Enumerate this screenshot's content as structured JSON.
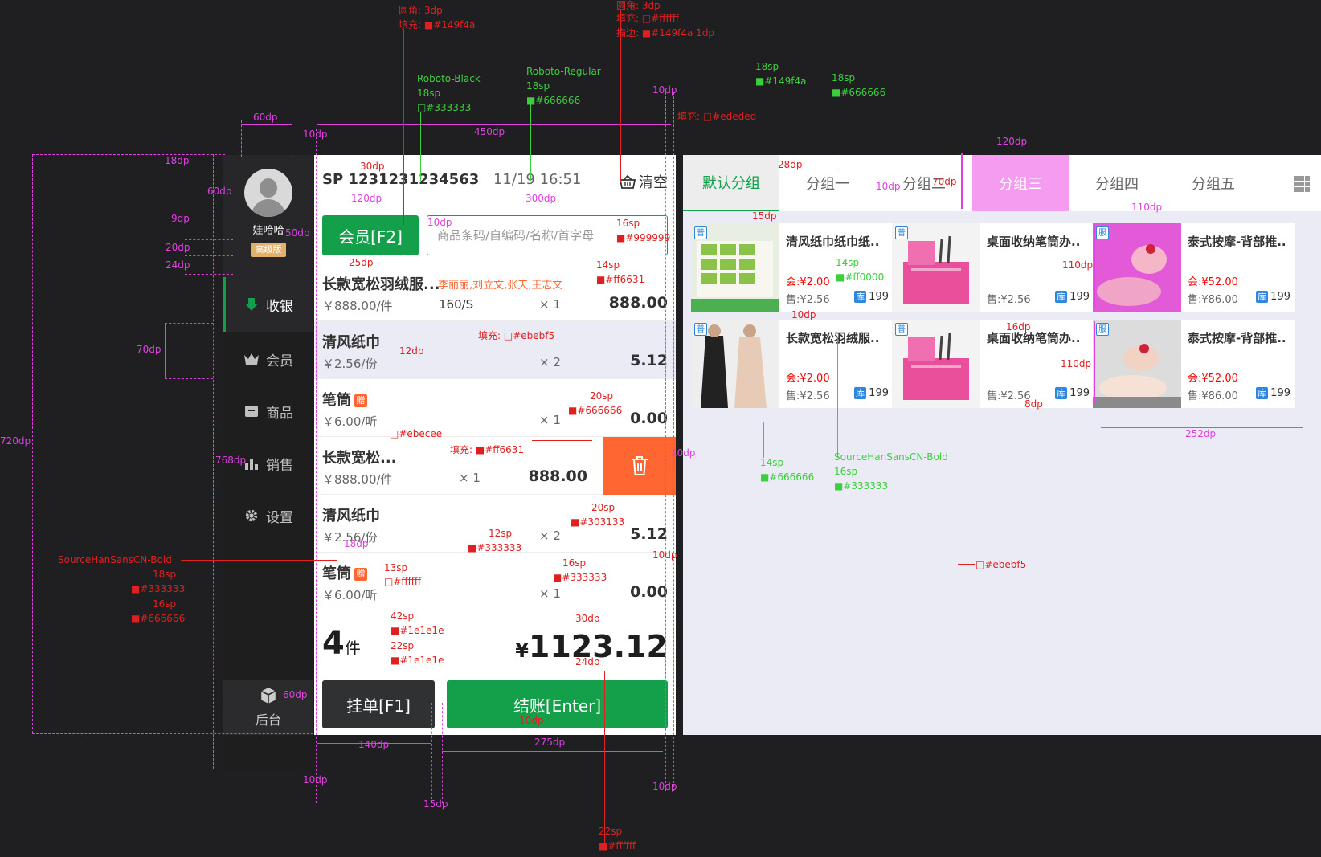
{
  "sidebar": {
    "user_name": "娃哈哈",
    "user_level": "高级版",
    "nav": [
      {
        "label": "收银",
        "icon": "download-arrow-icon",
        "active": true
      },
      {
        "label": "会员",
        "icon": "crown-icon",
        "active": false
      },
      {
        "label": "商品",
        "icon": "box-icon",
        "active": false
      },
      {
        "label": "销售",
        "icon": "bar-chart-icon",
        "active": false
      },
      {
        "label": "设置",
        "icon": "gear-icon",
        "active": false
      }
    ],
    "backend_label": "后台"
  },
  "cart": {
    "order_no": "SP 1231231234563",
    "order_time": "11/19  16:51",
    "clear_label": "清空",
    "member_button": "会员[F2]",
    "search_placeholder": "商品条码/自编码/名称/首字母",
    "items": [
      {
        "name": "长款宽松羽绒服...",
        "members": "李丽丽,刘立文,张天,王志文",
        "price": "￥888.00/件",
        "spec": "160/S",
        "qty": "× 1",
        "total": "888.00"
      },
      {
        "name": "清风纸巾",
        "price": "￥2.56/份",
        "qty": "× 2",
        "total": "5.12",
        "highlight": true
      },
      {
        "name": "笔筒",
        "gift": "赠",
        "price": "￥6.00/听",
        "qty": "× 1",
        "total": "0.00"
      },
      {
        "name": "长款宽松...",
        "price": "￥888.00/件",
        "qty": "× 1",
        "total": "888.00",
        "delete": true
      },
      {
        "name": "清风纸巾",
        "price": "￥2.56/份",
        "qty": "× 2",
        "total": "5.12"
      },
      {
        "name": "笔筒",
        "gift": "赠",
        "price": "￥6.00/听",
        "qty": "× 1",
        "total": "0.00"
      }
    ],
    "count": "4",
    "count_unit": "件",
    "currency": "¥",
    "total": "1123.12",
    "hold_button": "挂单[F1]",
    "pay_button": "结账[Enter]"
  },
  "products": {
    "tabs": [
      "默认分组",
      "分组一",
      "分组二",
      "分组三",
      "分组四",
      "分组五"
    ],
    "cards": [
      {
        "name": "清风纸巾纸巾纸..",
        "badge": "普",
        "member": "会:¥2.00",
        "sale": "售:¥2.56",
        "stock_label": "库",
        "stock": "199",
        "img": "tissue"
      },
      {
        "name": "桌面收纳笔筒办..",
        "badge": "普",
        "member": "",
        "sale": "售:¥2.56",
        "stock_label": "库",
        "stock": "199",
        "img": "pen"
      },
      {
        "name": "泰式按摩-背部推..",
        "badge": "服",
        "member": "会:¥52.00",
        "sale": "售:¥86.00",
        "stock_label": "库",
        "stock": "199",
        "img": "spa-pink"
      },
      {
        "name": "长款宽松羽绒服..",
        "badge": "普",
        "member": "会:¥2.00",
        "sale": "售:¥2.56",
        "stock_label": "库",
        "stock": "199",
        "img": "coat"
      },
      {
        "name": "桌面收纳笔筒办..",
        "badge": "普",
        "member": "",
        "sale": "售:¥2.56",
        "stock_label": "库",
        "stock": "199",
        "img": "pen"
      },
      {
        "name": "泰式按摩-背部推..",
        "badge": "服",
        "member": "会:¥52.00",
        "sale": "售:¥86.00",
        "stock_label": "库",
        "stock": "199",
        "img": "spa"
      }
    ]
  },
  "annotations": {
    "a01": "圆角: 3dp",
    "a02": "填充: ■#149f4a",
    "a03": "圆角: 3dp",
    "a04": "填充: □#ffffff",
    "a05": "描边: ■#149f4a 1dp",
    "a06": "Roboto-Black",
    "a07": "18sp",
    "a08": "□#333333",
    "a09": "Roboto-Regular",
    "a10": "18sp",
    "a11": "■#666666",
    "a12": "18sp",
    "a13": "■#149f4a",
    "a14": "18sp",
    "a15": "■#666666",
    "a16": "10dp",
    "a17": "填充: □#ededed",
    "a18": "120dp",
    "a19": "60dp",
    "a20": "10dp",
    "a21": "450dp",
    "a22": "18dp",
    "a23": "60dp",
    "a24": "9dp",
    "a25": "20dp",
    "a26": "24dp",
    "a27": "50dp",
    "a28": "30dp",
    "a29": "120dp",
    "a30": "300dp",
    "a31": "28dp",
    "a32": "10dp",
    "a33": "70dp",
    "a34": "15dp",
    "a35": "110dp",
    "a36": "16sp",
    "a37": "■#999999",
    "a38": "10dp",
    "a39": "25dp",
    "a40": "14sp",
    "a41": "■#ff6631",
    "a42": "14sp",
    "a43": "■#ff0000",
    "a44": "110dp",
    "a45": "10dp",
    "a46": "70dp",
    "a47": "12dp",
    "a48": "填充: □#ebebf5",
    "a49": "16dp",
    "a50": "110dp",
    "a51": "720dp",
    "a52": "20sp",
    "a53": "■#666666",
    "a54": "8dp",
    "a55": "252dp",
    "a56": "□#ebecee",
    "a57": "填充: ■#ff6631",
    "a58": "768dp",
    "a59": "10dp",
    "a60": "14sp",
    "a61": "■#666666",
    "a62": "SourceHanSansCN-Bold",
    "a63": "16sp",
    "a64": "■#333333",
    "a65": "20sp",
    "a66": "■#303133",
    "a67": "12sp",
    "a68": "■#333333",
    "a69": "18dp",
    "a70": "SourceHanSansCN-Bold",
    "a71": "18sp",
    "a72": "■#333333",
    "a73": "16sp",
    "a74": "■#666666",
    "a75": "13sp",
    "a76": "□#ffffff",
    "a77": "16sp",
    "a78": "■#333333",
    "a79": "10dp",
    "a80": "□#ebebf5",
    "a81": "42sp",
    "a82": "■#1e1e1e",
    "a83": "22sp",
    "a84": "■#1e1e1e",
    "a85": "30dp",
    "a86": "24dp",
    "a87": "60dp",
    "a88": "10dp",
    "a89": "140dp",
    "a90": "275dp",
    "a91": "10dp",
    "a92": "10dp",
    "a93": "15dp",
    "a94": "22sp",
    "a95": "■#ffffff"
  }
}
